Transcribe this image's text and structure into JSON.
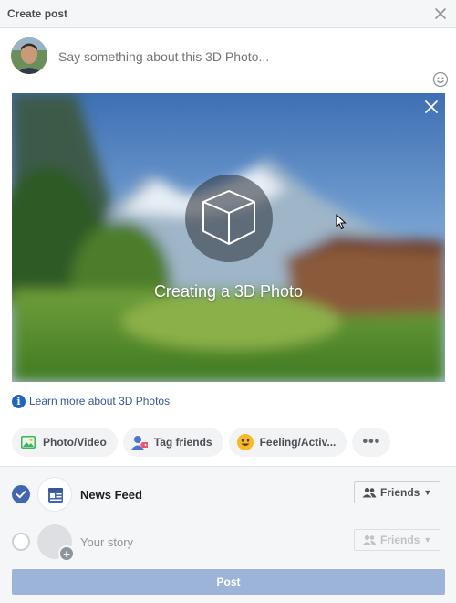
{
  "header": {
    "title": "Create post",
    "close_icon": "close-icon"
  },
  "composer": {
    "placeholder": "Say something about this 3D Photo...",
    "emoji_icon": "emoji-icon"
  },
  "preview": {
    "status_text": "Creating a 3D Photo",
    "icon": "cube-icon",
    "close_icon": "close-icon"
  },
  "learn_more": {
    "icon": "info-icon",
    "text": "Learn more about 3D Photos"
  },
  "actions": [
    {
      "label": "Photo/Video",
      "icon": "photo-icon"
    },
    {
      "label": "Tag friends",
      "icon": "tag-friends-icon"
    },
    {
      "label": "Feeling/Activ...",
      "icon": "emoji-icon"
    },
    {
      "label": "•••",
      "icon": "more-icon"
    }
  ],
  "destinations": [
    {
      "label": "News Feed",
      "checked": true,
      "audience": "Friends"
    },
    {
      "label": "Your story",
      "checked": false,
      "audience": "Friends"
    }
  ],
  "post_button": {
    "label": "Post"
  },
  "colors": {
    "accent": "#4267b2",
    "post_disabled": "#9cb4d8",
    "link": "#365899"
  }
}
